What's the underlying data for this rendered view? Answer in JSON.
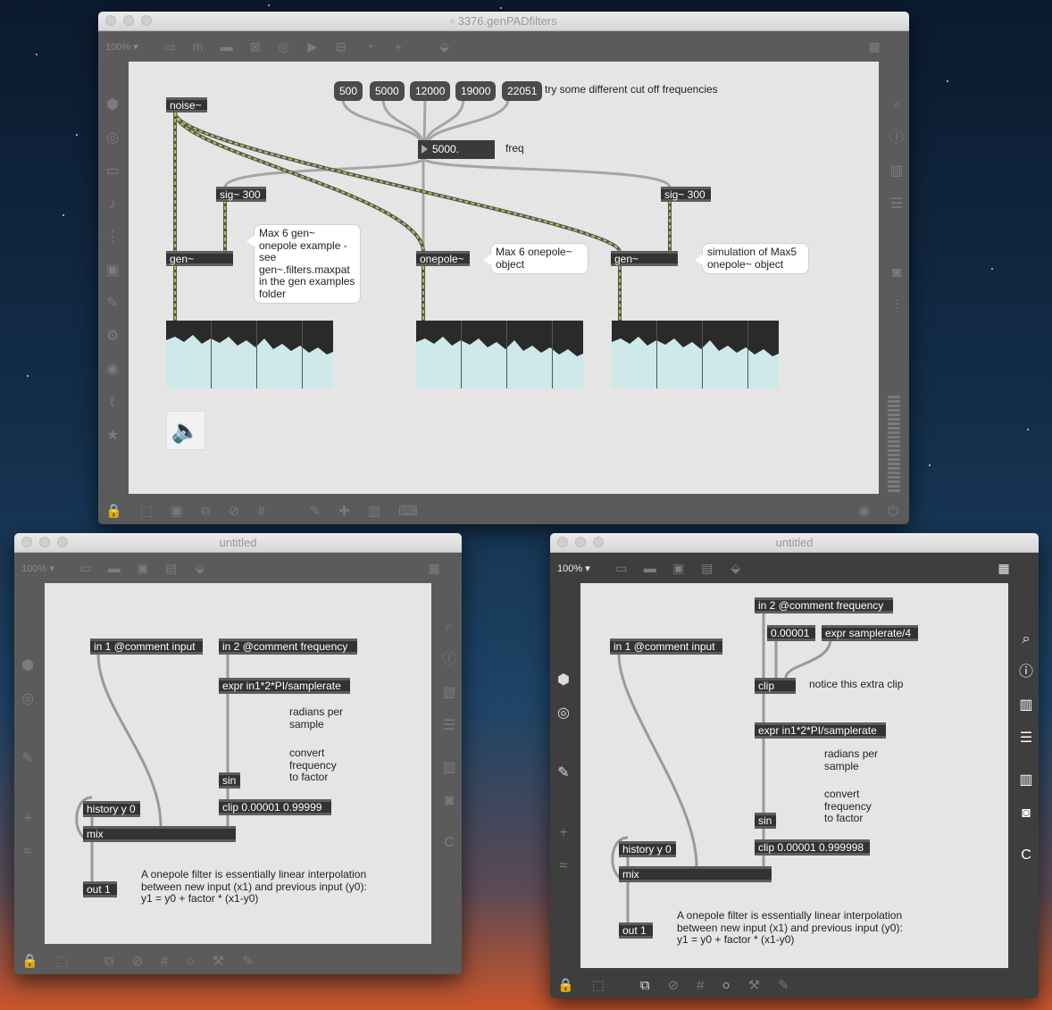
{
  "main_window": {
    "title": "3376.genPADfilters",
    "zoom": "100%",
    "message_boxes": [
      "500",
      "5000",
      "12000",
      "19000",
      "22051"
    ],
    "frequency_hint": "try some different cut off frequencies",
    "freq_value": "5000.",
    "freq_label": "freq",
    "objects": {
      "noise": "noise~",
      "sig_left": "sig~ 300",
      "sig_right": "sig~ 300",
      "gen_left": "gen~",
      "onepole": "onepole~",
      "gen_right": "gen~"
    },
    "bubble_left": "Max 6 gen~ onepole example - see gen~.filters.maxpat in the gen examples folder",
    "bubble_mid": "Max 6 onepole~ object",
    "bubble_right": "simulation of Max5 onepole~ object"
  },
  "left_window": {
    "title": "untitled",
    "zoom": "100%",
    "in1": "in 1 @comment input",
    "in2": "in 2 @comment frequency",
    "expr": "expr in1*2*PI/samplerate",
    "radians_comment": "radians per sample",
    "convert_comment": "convert frequency to factor",
    "sin": "sin",
    "clip": "clip 0.00001 0.99999",
    "history": "history y 0",
    "mix": "mix",
    "out": "out 1",
    "description": "A onepole filter is essentially linear interpolation between new input (x1) and previous input (y0): y1 = y0 + factor * (x1-y0)"
  },
  "right_window": {
    "title": "untitled",
    "zoom": "100%",
    "in1": "in 1 @comment input",
    "in2": "in 2 @comment frequency",
    "min_const": "0.00001",
    "expr_sr": "expr samplerate/4",
    "clip_top": "clip",
    "clip_comment": "notice this extra clip",
    "expr": "expr in1*2*PI/samplerate",
    "radians_comment": "radians per sample",
    "convert_comment": "convert frequency to factor",
    "sin": "sin",
    "clip": "clip 0.00001 0.999998",
    "history": "history y 0",
    "mix": "mix",
    "out": "out 1",
    "description": "A onepole filter is essentially linear interpolation between new input (x1) and previous input (y0): y1 = y0 + factor * (x1-y0)"
  },
  "colors": {
    "canvas": "#e5e5e5",
    "object_box": "#333333",
    "signal_cord": "#b6c04a",
    "control_cord": "#a5a5a5",
    "scope_fill": "#cfe8ea"
  }
}
